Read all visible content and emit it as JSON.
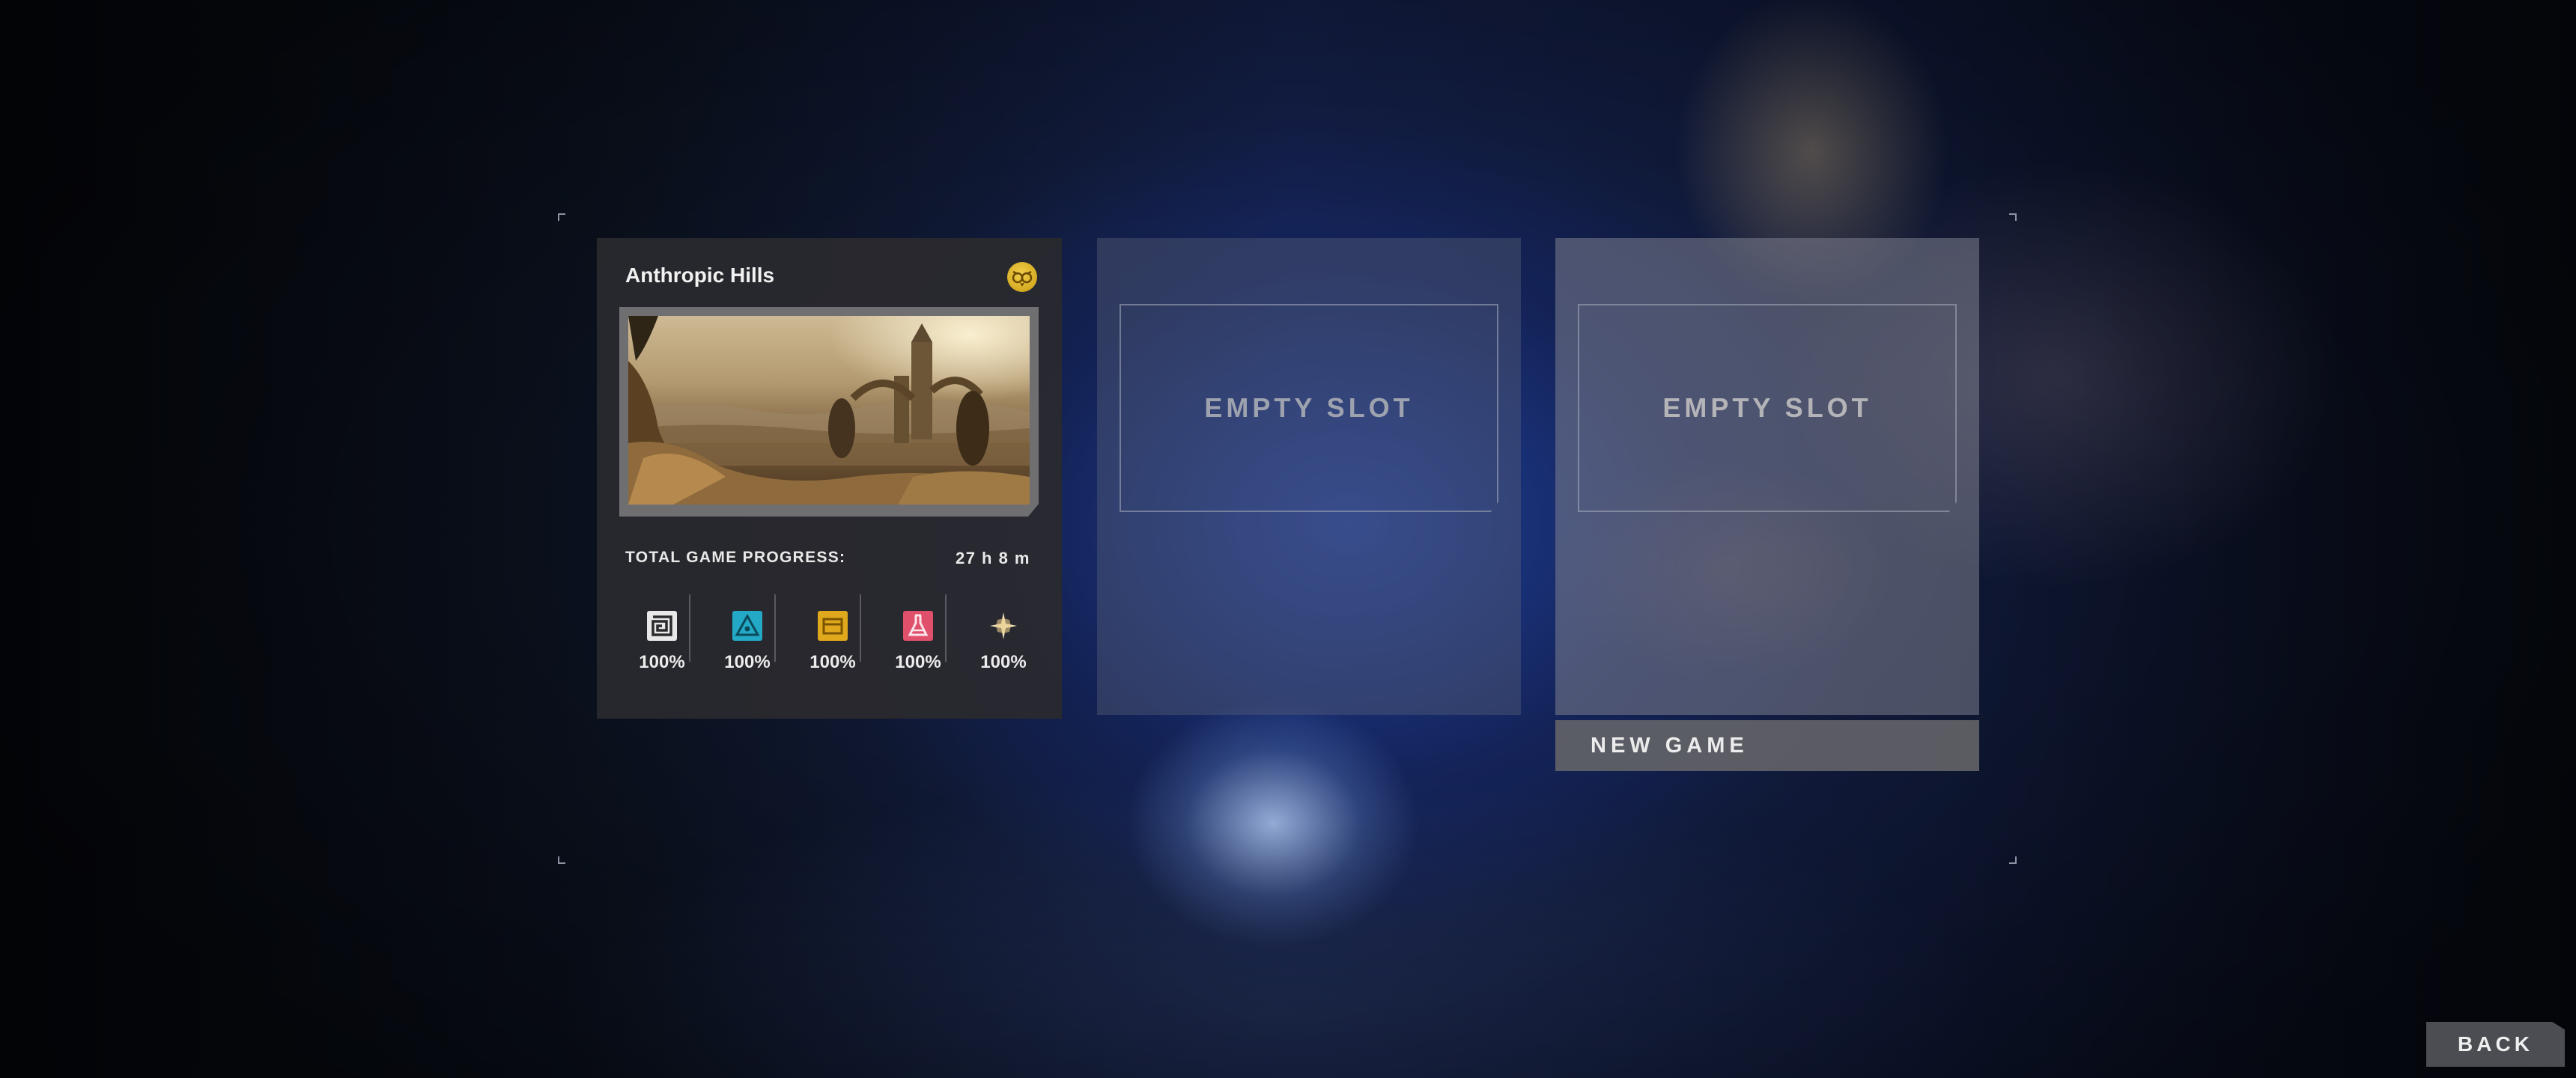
{
  "save_slots": [
    {
      "name": "Anthropic Hills",
      "badge_icon": "owl-face-icon",
      "progress_label": "TOTAL GAME PROGRESS:",
      "play_time": "27 h 8 m",
      "stats": [
        {
          "icon": "maze-glyph-icon",
          "color": "#e8e8e8",
          "value": "100%"
        },
        {
          "icon": "triangle-eye-icon",
          "color": "#23a9c6",
          "value": "100%"
        },
        {
          "icon": "treasure-chest-icon",
          "color": "#e0a81c",
          "value": "100%"
        },
        {
          "icon": "flask-icon",
          "color": "#e0506a",
          "value": "100%"
        },
        {
          "icon": "sparkle-icon",
          "color": "#f3e3b8",
          "value": "100%"
        }
      ]
    },
    {
      "label": "EMPTY SLOT"
    },
    {
      "label": "EMPTY SLOT"
    }
  ],
  "new_game_label": "NEW GAME",
  "back_label": "BACK",
  "colors": {
    "panel_dark": "#2a2a2e",
    "badge_gold": "#e2b52c",
    "button_gray": "#4b4d53"
  }
}
